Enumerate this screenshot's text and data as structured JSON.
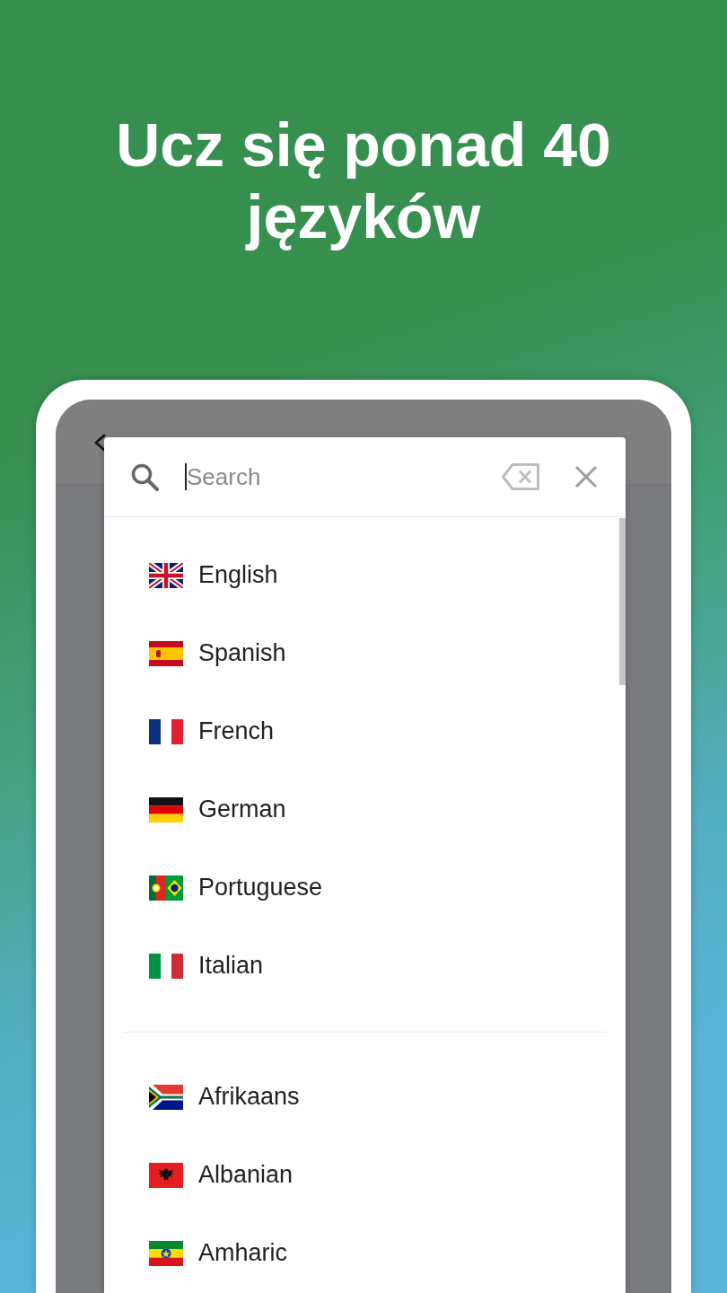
{
  "headline": {
    "lines": [
      "Ucz się ponad 40",
      "języków"
    ]
  },
  "search": {
    "placeholder": "Search",
    "focused": true
  },
  "language_groups": [
    {
      "items": [
        {
          "name": "English",
          "kind": "gb"
        },
        {
          "name": "Spanish",
          "kind": "es"
        },
        {
          "name": "French",
          "kind": "fr"
        },
        {
          "name": "German",
          "kind": "de"
        },
        {
          "name": "Portuguese",
          "kind": "pt-br"
        },
        {
          "name": "Italian",
          "kind": "it"
        }
      ]
    },
    {
      "items": [
        {
          "name": "Afrikaans",
          "kind": "za"
        },
        {
          "name": "Albanian",
          "kind": "al"
        },
        {
          "name": "Amharic",
          "kind": "et"
        }
      ]
    }
  ]
}
